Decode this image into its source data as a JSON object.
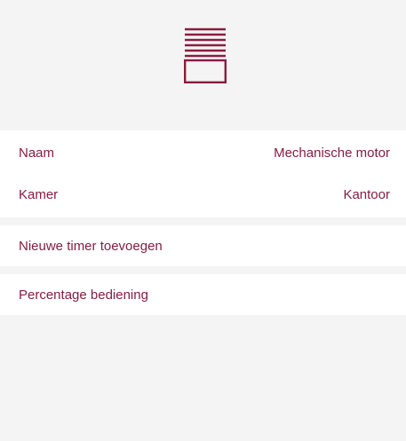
{
  "device": {
    "icon": "roller-shutter-icon",
    "accent_color": "#8a1c40"
  },
  "info": {
    "name_label": "Naam",
    "name_value": "Mechanische motor",
    "room_label": "Kamer",
    "room_value": "Kantoor"
  },
  "actions": {
    "add_timer_label": "Nieuwe timer toevoegen",
    "percentage_control_label": "Percentage bediening"
  }
}
